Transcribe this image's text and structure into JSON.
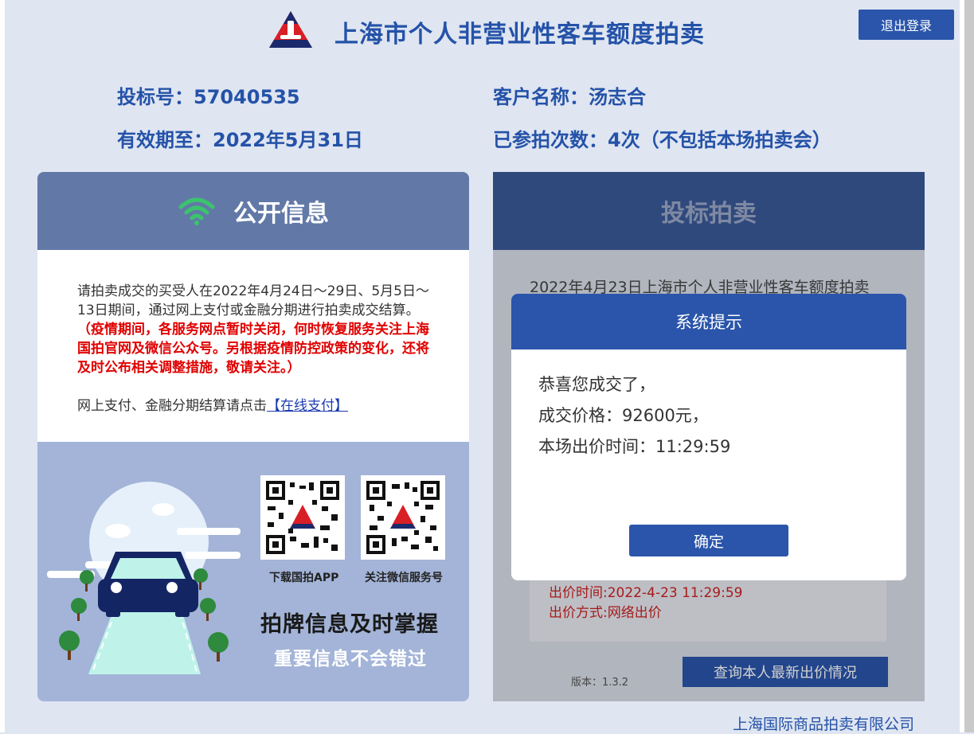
{
  "header": {
    "title": "上海市个人非营业性客车额度拍卖",
    "logout_label": "退出登录"
  },
  "user_info": {
    "bid_number": "投标号：57040535",
    "customer_name": "客户名称：汤志合",
    "valid_until": "有效期至：2022年5月31日",
    "participation_count": "已参拍次数：4次（不包括本场拍卖会）"
  },
  "public_panel": {
    "title": "公开信息",
    "notice_text": "请拍卖成交的买受人在2022年4月24日～29日、5月5日～13日期间，通过网上支付或金融分期进行拍卖成交结算。",
    "notice_red": "（疫情期间，各服务网点暂时关闭，何时恢复服务关注上海国拍官网及微信公众号。另根据疫情防控政策的变化，还将及时公布相关调整措施，敬请关注。）",
    "payment_prefix": "网上支付、金融分期结算请点击",
    "payment_link": "【在线支付】",
    "qr_app_label": "下载国拍APP",
    "qr_wechat_label": "关注微信服务号",
    "slogan_main": "拍牌信息及时掌握",
    "slogan_sub": "重要信息不会错过"
  },
  "auction_panel": {
    "title": "投标拍卖",
    "auction_name": "2022年4月23日上海市个人非营业性客车额度拍卖",
    "bid_time": "出价时间:2022-4-23 11:29:59",
    "bid_method": "出价方式:网络出价",
    "version": "版本：1.3.2",
    "query_label": "查询本人最新出价情况"
  },
  "modal": {
    "title": "系统提示",
    "line1": "恭喜您成交了，",
    "line2": "成交价格：92600元，",
    "line3": "本场出价时间：11:29:59",
    "ok_label": "确定"
  },
  "footer": {
    "company": "上海国际商品拍卖有限公司"
  },
  "colors": {
    "brand_blue": "#2a55aa",
    "title_blue": "#2452a8",
    "alert_red": "#e00000",
    "wifi_green": "#3bc46c"
  }
}
